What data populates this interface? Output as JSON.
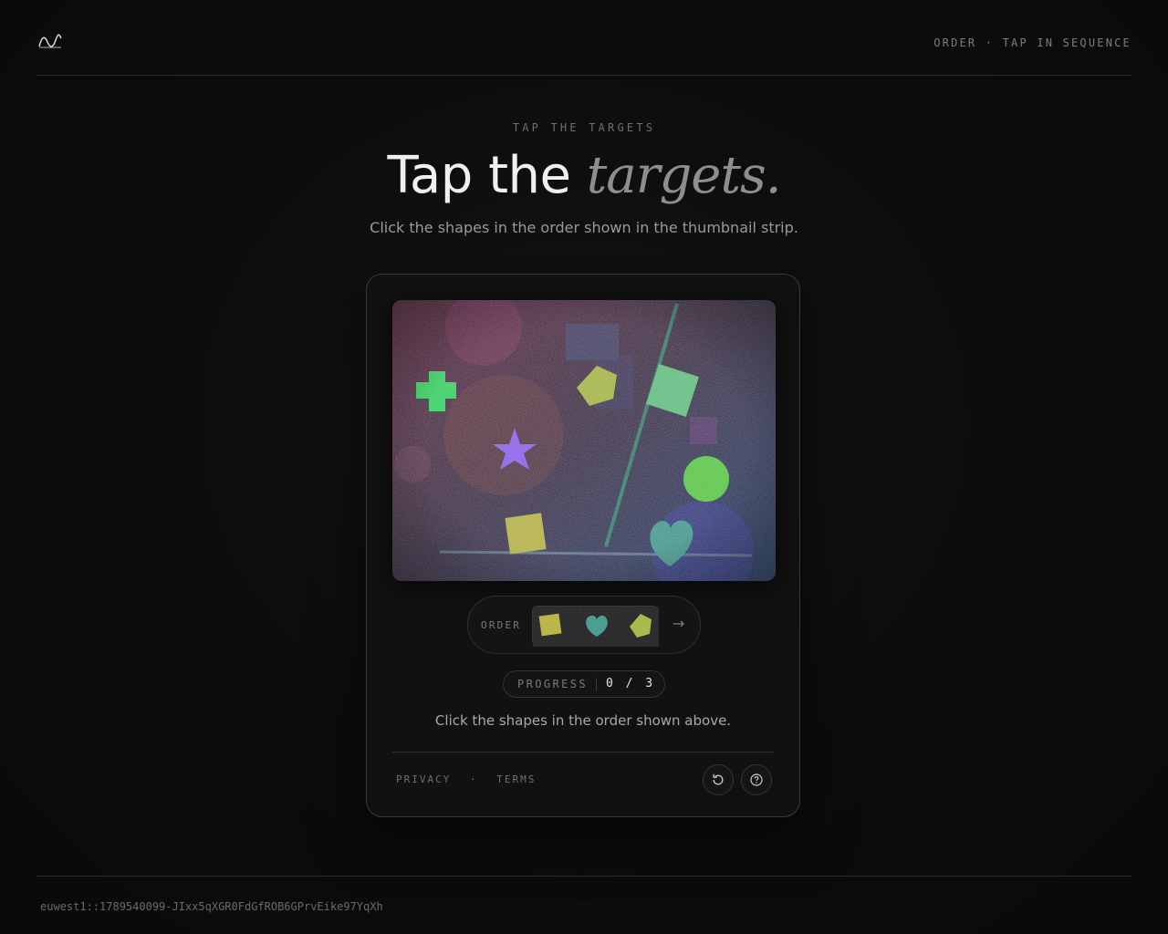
{
  "header": {
    "logo_icon": "wave-logo-icon",
    "meta": "ORDER · TAP IN SEQUENCE"
  },
  "hero": {
    "eyebrow": "TAP THE TARGETS",
    "title_plain": "Tap the ",
    "title_italic": "targets.",
    "subtitle": "Click the shapes in the order shown in the thumbnail strip."
  },
  "challenge": {
    "order_label": "ORDER",
    "order_sequence": [
      "square-icon",
      "heart-icon",
      "pentagon-icon"
    ],
    "next_icon": "arrow-right-icon",
    "next_arrow": "→",
    "progress_label": "PROGRESS",
    "progress_value": "0 / 3",
    "instructions": "Click the shapes in the order shown above.",
    "colors": {
      "cross": "#2fd65a",
      "star": "#8a5cf0",
      "pentagon": "#a6b83a",
      "square_tilted": "#5ec27a",
      "circle": "#55cc3c",
      "square": "#b8b43c",
      "heart": "#3e9a8a"
    }
  },
  "footer": {
    "privacy": "PRIVACY",
    "separator": "·",
    "terms": "TERMS",
    "refresh_icon": "refresh-icon",
    "help_icon": "help-icon"
  },
  "session_id": "euwest1::1789540099-JIxx5qXGR0FdGfROB6GPrvEike97YqXh"
}
